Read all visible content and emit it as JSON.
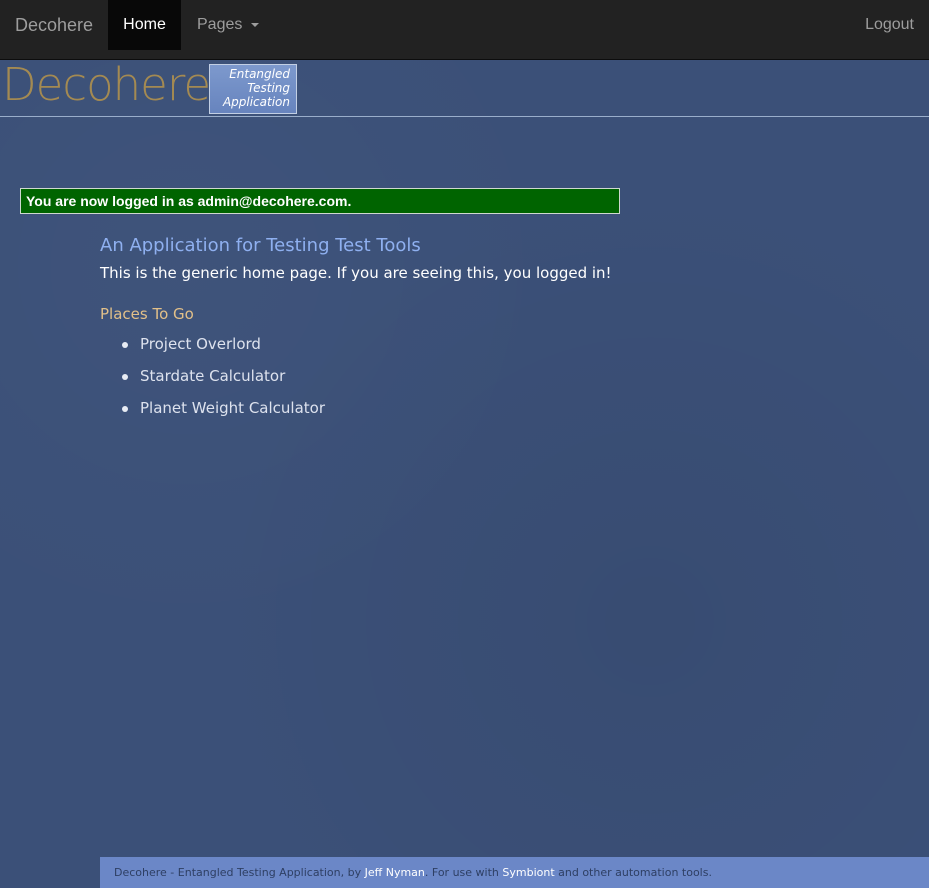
{
  "navbar": {
    "brand": "Decohere",
    "home": "Home",
    "pages": "Pages",
    "logout": "Logout"
  },
  "header": {
    "logo_text": "Decohere",
    "badge": [
      "Entangled",
      "Testing",
      "Application"
    ]
  },
  "flash": {
    "message": "You are now logged in as admin@decohere.com."
  },
  "main": {
    "title": "An Application for Testing Test Tools",
    "intro": "This is the generic home page. If you are seeing this, you logged in!",
    "places_heading": "Places To Go",
    "places": [
      "Project Overlord",
      "Stardate Calculator",
      "Planet Weight Calculator"
    ]
  },
  "footer": {
    "prefix": "Decohere - Entangled Testing Application, by",
    "author": "Jeff Nyman",
    "middle": ". For use with",
    "tool": "Symbiont",
    "suffix": "and other automation tools."
  },
  "colors": {
    "background": "#3b5078",
    "navbar": "#222222",
    "logo": "#a48a52",
    "flash": "#006400",
    "title": "#8fb0f0",
    "heading": "#e2c089",
    "footer": "#6b87c7"
  }
}
